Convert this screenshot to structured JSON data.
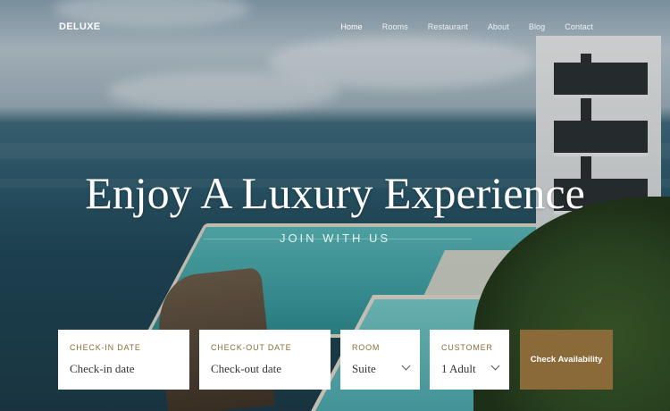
{
  "nav": {
    "logo": "DELUXE",
    "items": [
      {
        "label": "Home",
        "active": true
      },
      {
        "label": "Rooms",
        "active": false
      },
      {
        "label": "Restaurant",
        "active": false
      },
      {
        "label": "About",
        "active": false
      },
      {
        "label": "Blog",
        "active": false
      },
      {
        "label": "Contact",
        "active": false
      }
    ]
  },
  "hero": {
    "title": "Enjoy A Luxury Experience",
    "subtitle": "JOIN WITH US"
  },
  "booking": {
    "checkin": {
      "label": "CHECK-IN DATE",
      "placeholder": "Check-in date"
    },
    "checkout": {
      "label": "CHECK-OUT DATE",
      "placeholder": "Check-out date"
    },
    "room": {
      "label": "ROOM",
      "value": "Suite"
    },
    "customer": {
      "label": "CUSTOMER",
      "value": "1 Adult"
    },
    "submit": "Check Availability"
  },
  "colors": {
    "accent": "#8a6a38",
    "label": "#8a6d3b"
  }
}
